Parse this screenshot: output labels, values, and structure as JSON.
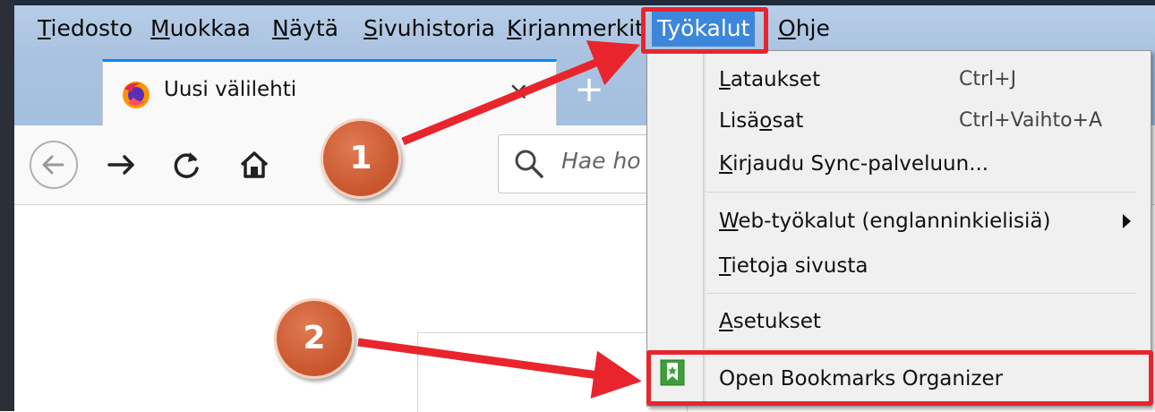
{
  "menubar": {
    "items": [
      {
        "prefix": "",
        "underline": "T",
        "rest": "iedosto"
      },
      {
        "prefix": "",
        "underline": "M",
        "rest": "uokkaa"
      },
      {
        "prefix": "",
        "underline": "N",
        "rest": "äytä"
      },
      {
        "prefix": "",
        "underline": "S",
        "rest": "ivuhistoria"
      },
      {
        "prefix": "",
        "underline": "K",
        "rest": "irjanmerkit"
      },
      {
        "prefix": "",
        "underline": "",
        "rest": "Työkalut"
      },
      {
        "prefix": "",
        "underline": "O",
        "rest": "hje"
      }
    ]
  },
  "tab": {
    "title": "Uusi välilehti",
    "close": "×",
    "new_tab": "+"
  },
  "navbar": {
    "search_placeholder": "Hae ho"
  },
  "tools_menu": {
    "items": [
      {
        "underline": "L",
        "rest": "ataukset",
        "shortcut": "Ctrl+J"
      },
      {
        "prefix": "Lisä",
        "underline": "o",
        "rest": "sat",
        "shortcut": "Ctrl+Vaihto+A"
      },
      {
        "underline": "K",
        "rest": "irjaudu Sync-palveluun..."
      },
      {
        "underline": "W",
        "rest": "eb-työkalut (englanninkielisiä)"
      },
      {
        "underline": "T",
        "rest": "ietoja sivusta"
      },
      {
        "underline": "A",
        "rest": "setukset"
      },
      {
        "label": "Open Bookmarks Organizer"
      }
    ]
  },
  "annotations": {
    "badge_1": "1",
    "badge_2": "2"
  },
  "colors": {
    "highlight": "#e8252c",
    "active_menu": "#3c87dc",
    "badge": "#c8552d"
  }
}
